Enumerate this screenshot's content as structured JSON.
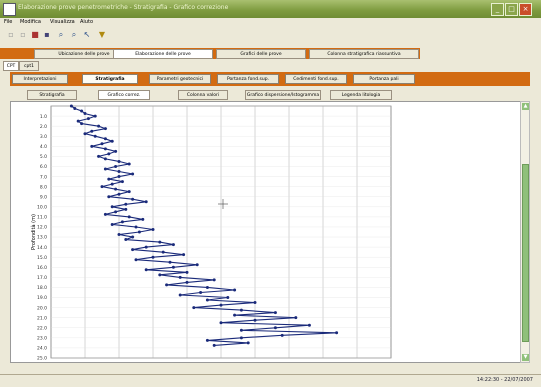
{
  "window": {
    "title": "Elaborazione prove penetrometriche - Stratigrafia - Grafico correzione",
    "controls": [
      "_",
      "□",
      "×"
    ]
  },
  "menu": [
    "File",
    "Modifica",
    "Visualizza",
    "Aiuto"
  ],
  "toolbar": {
    "icons": [
      "new-icon",
      "open-icon",
      "save-icon",
      "print-icon",
      "zoom-in-icon",
      "zoom-out-icon",
      "pan-icon",
      "filter-icon"
    ]
  },
  "main_tabs": [
    "Ubicazione delle prove",
    "Elaborazione delle prove",
    "Grafici delle prove",
    "Colonna stratigrafica riassuntiva"
  ],
  "test_tabs": [
    "CPT",
    "cpt1"
  ],
  "section_buttons": [
    "Interpretazioni",
    "Stratigrafia",
    "Parametri geotecnici",
    "Portanza fond.sup.",
    "Cedimenti fond.sup.",
    "Portanza pali"
  ],
  "chart_tabs": [
    "Stratigrafia",
    "Grafico correz.",
    "Colonna valori",
    "Grafico dispersione/Istogramma",
    "Legenda litologia"
  ],
  "colors": {
    "accent": "#d26b12",
    "series": "#1a2a7a",
    "scroll": "#8fc07a"
  },
  "chart_data": {
    "type": "line",
    "title": "",
    "xlabel": "",
    "ylabel": "Profondità (m)",
    "grid": true,
    "ylim": [
      0,
      25
    ],
    "xlim": [
      0,
      10
    ],
    "series": [
      {
        "x": [
          0.6,
          0.7,
          0.9,
          1.0,
          1.3,
          1.1,
          0.8,
          0.9,
          1.4,
          1.6,
          1.2,
          1.0,
          1.3,
          1.6,
          1.8,
          1.5,
          1.2,
          1.6,
          1.9,
          1.7,
          1.4,
          1.6,
          2.0,
          2.3,
          1.9,
          1.6,
          2.0,
          2.4,
          2.0,
          1.7,
          2.1,
          1.8,
          1.5,
          1.9,
          2.3,
          2.0,
          1.7,
          2.4,
          2.8,
          2.2,
          1.8,
          2.2,
          1.9,
          1.6,
          2.3,
          2.7,
          2.1,
          1.8,
          2.5,
          3.0,
          2.6,
          2.0,
          2.4,
          2.2,
          3.2,
          3.6,
          2.8,
          2.4,
          3.3,
          3.9,
          3.0,
          2.5,
          3.5,
          4.3,
          3.6,
          2.8,
          4.0,
          3.2,
          3.8,
          4.8,
          4.0,
          3.4,
          4.6,
          5.4,
          4.4,
          3.8,
          5.2,
          4.6,
          6.0,
          5.0,
          4.2,
          5.6,
          6.6,
          5.4,
          7.2,
          6.0,
          5.0,
          7.6,
          6.6,
          5.6,
          8.4,
          6.8,
          5.6,
          4.6,
          5.8,
          4.8
        ],
        "y": [
          0.0,
          0.25,
          0.5,
          0.75,
          1.0,
          1.25,
          1.5,
          1.75,
          2.0,
          2.25,
          2.5,
          2.75,
          3.0,
          3.25,
          3.5,
          3.75,
          4.0,
          4.25,
          4.5,
          4.75,
          5.0,
          5.25,
          5.5,
          5.75,
          6.0,
          6.25,
          6.5,
          6.75,
          7.0,
          7.25,
          7.5,
          7.75,
          8.0,
          8.25,
          8.5,
          8.75,
          9.0,
          9.25,
          9.5,
          9.75,
          10.0,
          10.25,
          10.5,
          10.75,
          11.0,
          11.25,
          11.5,
          11.75,
          12.0,
          12.25,
          12.5,
          12.75,
          13.0,
          13.25,
          13.5,
          13.75,
          14.0,
          14.25,
          14.5,
          14.75,
          15.0,
          15.25,
          15.5,
          15.75,
          16.0,
          16.25,
          16.5,
          16.75,
          17.0,
          17.25,
          17.5,
          17.75,
          18.0,
          18.25,
          18.5,
          18.75,
          19.0,
          19.25,
          19.5,
          19.75,
          20.0,
          20.25,
          20.5,
          20.75,
          21.0,
          21.25,
          21.5,
          21.75,
          22.0,
          22.25,
          22.5,
          22.75,
          23.0,
          23.25,
          23.5,
          23.75
        ]
      }
    ]
  },
  "status": "14:22:30 - 22/07/2007"
}
